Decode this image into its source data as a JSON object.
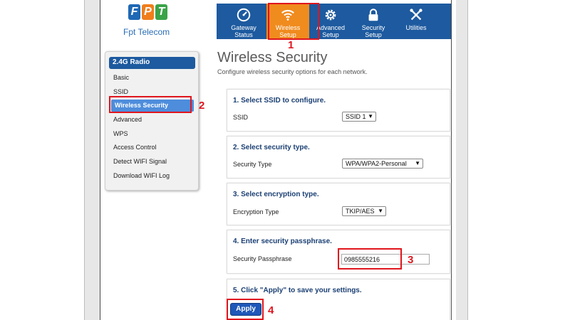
{
  "brand": {
    "logo_letters": [
      "F",
      "P",
      "T"
    ],
    "logo_colors": [
      "#1f68b5",
      "#f07e1b",
      "#3aa348"
    ],
    "name": "Fpt Telecom"
  },
  "nav": {
    "items": [
      {
        "label_line1": "Gateway",
        "label_line2": "Status",
        "icon": "gauge-icon"
      },
      {
        "label_line1": "Wireless",
        "label_line2": "Setup",
        "icon": "wifi-icon"
      },
      {
        "label_line1": "Advanced",
        "label_line2": "Setup",
        "icon": "gear-icon"
      },
      {
        "label_line1": "Security",
        "label_line2": "Setup",
        "icon": "lock-icon"
      },
      {
        "label_line1": "Utilities",
        "label_line2": "",
        "icon": "tools-icon"
      }
    ],
    "active_color": "#f08b1e",
    "bar_color": "#1d5a9f"
  },
  "sidebar": {
    "header": "2.4G Radio",
    "items": [
      "Basic",
      "SSID",
      "Wireless Security",
      "Advanced",
      "WPS",
      "Access Control",
      "Detect WIFI Signal",
      "Download WIFI Log"
    ],
    "active_index": 2
  },
  "main": {
    "title": "Wireless Security",
    "subtitle": "Configure wireless security options for each network.",
    "sections": [
      {
        "title": "1. Select SSID to configure.",
        "label": "SSID",
        "value": "SSID 1"
      },
      {
        "title": "2. Select security type.",
        "label": "Security Type",
        "value": "WPA/WPA2-Personal"
      },
      {
        "title": "3. Select encryption type.",
        "label": "Encryption Type",
        "value": "TKIP/AES"
      },
      {
        "title": "4. Enter security passphrase.",
        "label": "Security Passphrase",
        "value": "0985555216"
      },
      {
        "title": "5. Click \"Apply\" to save your settings."
      }
    ],
    "apply_label": "Apply"
  },
  "annotations": [
    "1",
    "2",
    "3",
    "4"
  ],
  "annotation_color": "#e0151d"
}
